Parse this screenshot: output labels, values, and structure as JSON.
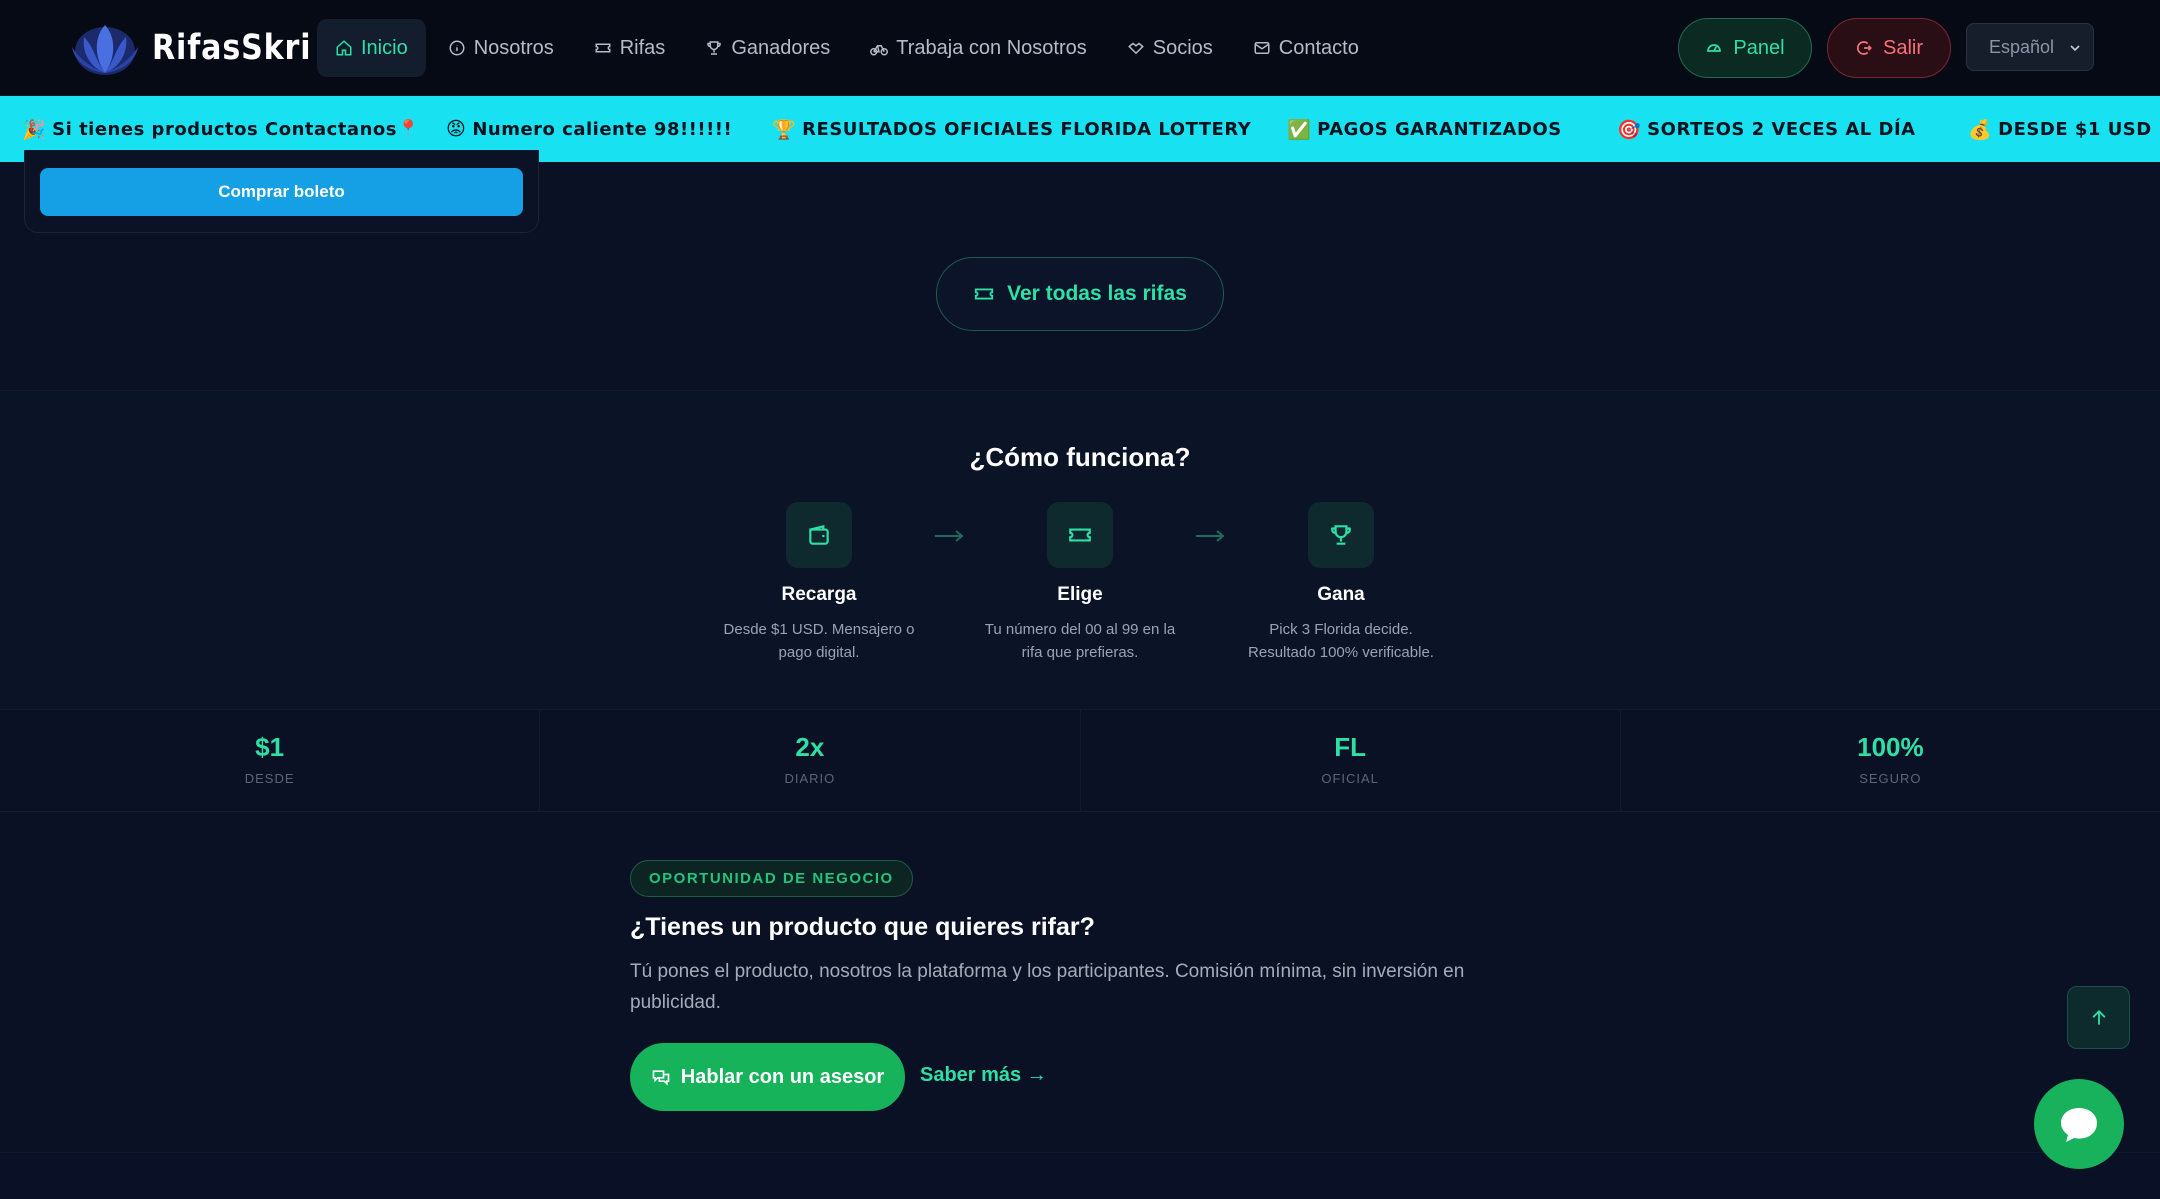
{
  "brand": {
    "name": "RifasSkri"
  },
  "nav": {
    "items": [
      {
        "label": "Inicio",
        "icon": "home-icon",
        "active": true
      },
      {
        "label": "Nosotros",
        "icon": "info-icon"
      },
      {
        "label": "Rifas",
        "icon": "ticket-icon"
      },
      {
        "label": "Ganadores",
        "icon": "trophy-icon"
      },
      {
        "label": "Trabaja con Nosotros",
        "icon": "bike-icon"
      },
      {
        "label": "Socios",
        "icon": "handshake-icon"
      },
      {
        "label": "Contacto",
        "icon": "mail-icon"
      }
    ],
    "panel_label": "Panel",
    "logout_label": "Salir",
    "language": "Español"
  },
  "ticker": {
    "items": [
      {
        "emoji": "🎉",
        "text": "Si tienes productos Contactanos📍"
      },
      {
        "emoji": "😡",
        "text": "Numero caliente 98!!!!!!"
      },
      {
        "emoji": "🏆",
        "text": "RESULTADOS OFICIALES FLORIDA LOTTERY"
      },
      {
        "emoji": "✅",
        "text": "PAGOS GARANTIZADOS"
      },
      {
        "emoji": "🎯",
        "text": "SORTEOS 2 VECES AL DÍA"
      },
      {
        "emoji": "💰",
        "text": "DESDE $1 USD"
      }
    ]
  },
  "raffle": {
    "buy_label": "Comprar boleto"
  },
  "see_all_label": "Ver todas las rifas",
  "how": {
    "title": "¿Cómo funciona?",
    "steps": [
      {
        "title": "Recarga",
        "desc": "Desde $1 USD. Mensajero o pago digital.",
        "icon": "wallet-icon"
      },
      {
        "title": "Elige",
        "desc": "Tu número del 00 al 99 en la rifa que prefieras.",
        "icon": "ticket-icon"
      },
      {
        "title": "Gana",
        "desc": "Pick 3 Florida decide. Resultado 100% verificable.",
        "icon": "trophy-icon"
      }
    ]
  },
  "stats": [
    {
      "value": "$1",
      "label": "DESDE"
    },
    {
      "value": "2x",
      "label": "DIARIO"
    },
    {
      "value": "FL",
      "label": "OFICIAL"
    },
    {
      "value": "100%",
      "label": "SEGURO"
    }
  ],
  "business": {
    "badge": "OPORTUNIDAD DE NEGOCIO",
    "title": "¿Tienes un producto que quieres rifar?",
    "text": "Tú pones el producto, nosotros la plataforma y los participantes. Comisión mínima, sin inversión en publicidad.",
    "cta_label": "Hablar con un asesor",
    "more_label": "Saber más →"
  },
  "colors": {
    "accent": "#2ee0a5",
    "ticker_bg": "#18e2f2",
    "buy_button": "#15a0e6",
    "cta_green": "#16b35b",
    "logout_red": "#f8707a",
    "background": "#0a1124"
  }
}
